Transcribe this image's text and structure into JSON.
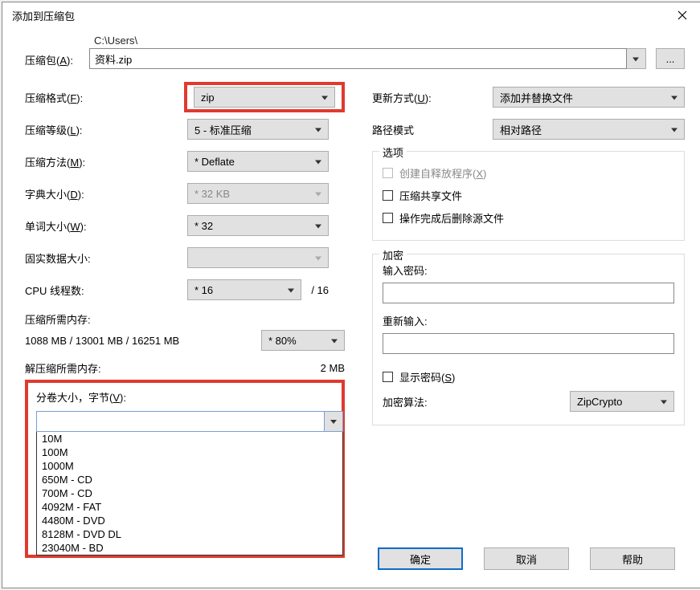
{
  "title": "添加到压缩包",
  "archive": {
    "label_text": "压缩包(",
    "label_key": "A",
    "label_close": "):",
    "path": "C:\\Users\\",
    "filename": "资料.zip",
    "browse": "..."
  },
  "left": {
    "format": {
      "label_text": "压缩格式(",
      "label_key": "F",
      "label_close": "):",
      "value": "zip"
    },
    "level": {
      "label_text": "压缩等级(",
      "label_key": "L",
      "label_close": "):",
      "value": "5 - 标准压缩"
    },
    "method": {
      "label_text": "压缩方法(",
      "label_key": "M",
      "label_close": "):",
      "value": "* Deflate"
    },
    "dict": {
      "label_text": "字典大小(",
      "label_key": "D",
      "label_close": "):",
      "value": "* 32 KB"
    },
    "word": {
      "label_text": "单词大小(",
      "label_key": "W",
      "label_close": "):",
      "value": "* 32"
    },
    "solid": {
      "label": "固实数据大小:",
      "value": ""
    },
    "cpu": {
      "label": "CPU 线程数:",
      "value": "* 16",
      "total": "/ 16"
    },
    "memcomp": {
      "label": "压缩所需内存:",
      "sub": "1088 MB / 13001 MB / 16251 MB",
      "value": "* 80%"
    },
    "memdecomp": {
      "label": "解压缩所需内存:",
      "value": "2 MB"
    },
    "volume": {
      "label_text": "分卷大小，字节(",
      "label_key": "V",
      "label_close": "):",
      "options": [
        "10M",
        "100M",
        "1000M",
        "650M - CD",
        "700M - CD",
        "4092M - FAT",
        "4480M - DVD",
        "8128M - DVD DL",
        "23040M - BD"
      ]
    }
  },
  "right": {
    "update": {
      "label_text": "更新方式(",
      "label_key": "U",
      "label_close": "):",
      "value": "添加并替换文件"
    },
    "pathmode": {
      "label": "路径模式",
      "value": "相对路径"
    },
    "options_legend": "选项",
    "opt_sfx_text": "创建自释放程序(",
    "opt_sfx_key": "X",
    "opt_sfx_close": ")",
    "opt_shared": "压缩共享文件",
    "opt_delete": "操作完成后删除源文件",
    "enc_legend": "加密",
    "pwd_label": "输入密码:",
    "pwd2_label": "重新输入:",
    "showpwd_text": "显示密码(",
    "showpwd_key": "S",
    "showpwd_close": ")",
    "algo_label": "加密算法:",
    "algo_value": "ZipCrypto"
  },
  "buttons": {
    "ok": "确定",
    "cancel": "取消",
    "help": "帮助"
  }
}
